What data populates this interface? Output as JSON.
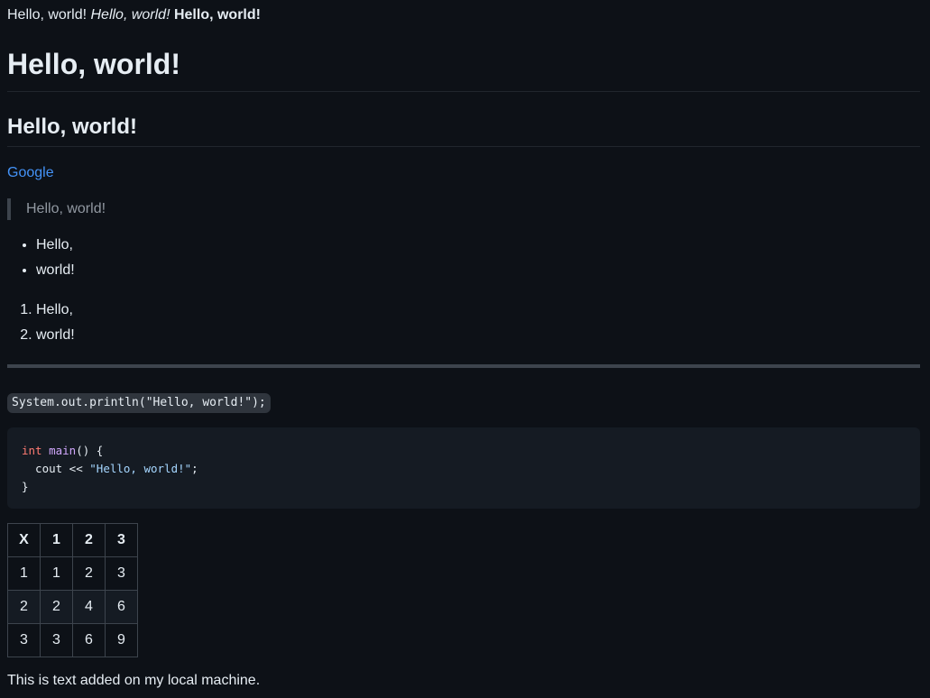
{
  "line1": {
    "plain": "Hello, world!",
    "italic": "Hello, world!",
    "bold": "Hello, world!"
  },
  "h1": "Hello, world!",
  "h2": "Hello, world!",
  "link": {
    "label": "Google"
  },
  "blockquote": "Hello, world!",
  "ul": [
    "Hello,",
    "world!"
  ],
  "ol": [
    "Hello,",
    "world!"
  ],
  "inline_code": "System.out.println(\"Hello, world!\");",
  "code_block": {
    "l1_kw": "int",
    "l1_fn": "main",
    "l1_rest": "() {",
    "l2_pre": "  cout << ",
    "l2_str": "\"Hello, world!\"",
    "l2_post": ";",
    "l3": "}"
  },
  "table": {
    "headers": [
      "X",
      "1",
      "2",
      "3"
    ],
    "rows": [
      [
        "1",
        "1",
        "2",
        "3"
      ],
      [
        "2",
        "2",
        "4",
        "6"
      ],
      [
        "3",
        "3",
        "6",
        "9"
      ]
    ]
  },
  "footer_text": "This is text added on my local machine."
}
